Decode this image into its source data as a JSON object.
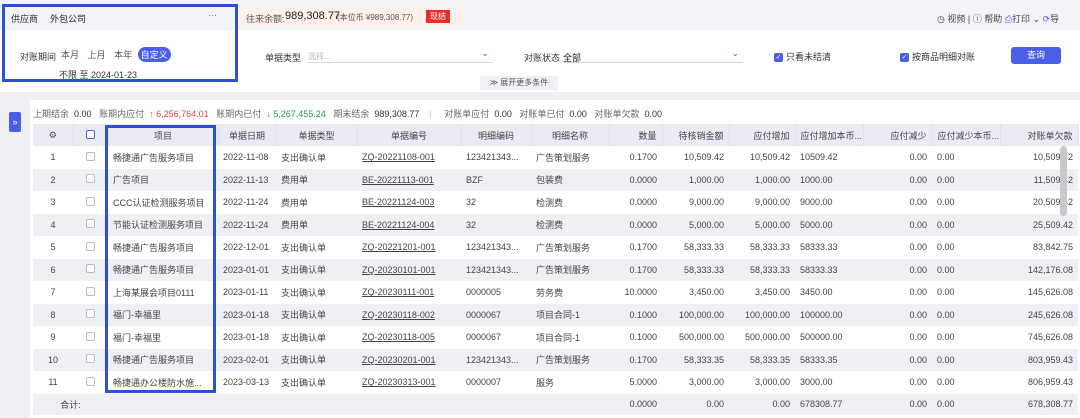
{
  "supplier": {
    "label": "供应商",
    "value": "外包公司",
    "more": "···"
  },
  "balance": {
    "label": "往来余额:",
    "value": "989,308.77",
    "local": "(本位币 ¥989,308.77)",
    "settle_button": "现结"
  },
  "toolbar": {
    "video": "视频",
    "help": "帮助",
    "print": "打印",
    "export": "导"
  },
  "period": {
    "label": "对账期间",
    "options": [
      "本月",
      "上月",
      "本年",
      "自定义"
    ],
    "selected": "自定义",
    "range": "不限 至 2024-01-23"
  },
  "doc_type": {
    "label": "单据类型",
    "placeholder": "选择..."
  },
  "status": {
    "label": "对账状态",
    "value": "全部"
  },
  "checks": {
    "unsettled_only": "只看未结清",
    "by_item_detail": "按商品明细对账"
  },
  "query_button": "查询",
  "expand_more": "展开更多条件",
  "summary": {
    "prev_balance_label": "上期结余",
    "prev_balance": "0.00",
    "payable_label": "账期内应付",
    "payable": "6,256,764.01",
    "paid_label": "账期内已付",
    "paid": "5,267,455.24",
    "end_balance_label": "期末结余",
    "end_balance": "989,308.77",
    "stmt_payable_label": "对账单应付",
    "stmt_payable": "0.00",
    "stmt_paid_label": "对账单已付",
    "stmt_paid": "0.00",
    "stmt_owed_label": "对账单欠款",
    "stmt_owed": "0.00"
  },
  "colors": {
    "accent": "#4a5ee8",
    "up": "#e64545",
    "down": "#1e9e4a",
    "highlight": "#2f50cf"
  },
  "table": {
    "headers": [
      "项目",
      "单据日期",
      "单据类型",
      "单据编号",
      "明细编码",
      "明细名称",
      "数量",
      "待核销金额",
      "应付增加",
      "应付增加本币...",
      "应付减少",
      "应付减少本币...",
      "对账单欠款"
    ],
    "rows": [
      [
        "1",
        "畅捷通广告服务项目",
        "2022-11-08",
        "支出确认单",
        "ZQ-20221108-001",
        "123421343...",
        "广告策划服务",
        "0.1700",
        "10,509.42",
        "10,509.42",
        "10509.42",
        "0.00",
        "0.00",
        "10,509.42"
      ],
      [
        "2",
        "广告项目",
        "2022-11-13",
        "费用单",
        "BE-20221113-001",
        "BZF",
        "包装费",
        "0.0000",
        "1,000.00",
        "1,000.00",
        "1000.00",
        "0.00",
        "0.00",
        "11,509.42"
      ],
      [
        "3",
        "CCC认证检测服务项目",
        "2022-11-24",
        "费用单",
        "BE-20221124-003",
        "32",
        "检测费",
        "0.0000",
        "9,000.00",
        "9,000.00",
        "9000.00",
        "0.00",
        "0.00",
        "20,509.42"
      ],
      [
        "4",
        "节能认证检测服务项目",
        "2022-11-24",
        "费用单",
        "BE-20221124-004",
        "32",
        "检测费",
        "0.0000",
        "5,000.00",
        "5,000.00",
        "5000.00",
        "0.00",
        "0.00",
        "25,509.42"
      ],
      [
        "5",
        "畅捷通广告服务项目",
        "2022-12-01",
        "支出确认单",
        "ZQ-20221201-001",
        "123421343...",
        "广告策划服务",
        "0.1700",
        "58,333.33",
        "58,333.33",
        "58333.33",
        "0.00",
        "0.00",
        "83,842.75"
      ],
      [
        "6",
        "畅捷通广告服务项目",
        "2023-01-01",
        "支出确认单",
        "ZQ-20230101-001",
        "123421343...",
        "广告策划服务",
        "0.1700",
        "58,333.33",
        "58,333.33",
        "58333.33",
        "0.00",
        "0.00",
        "142,176.08"
      ],
      [
        "7",
        "上海某展会项目0111",
        "2023-01-11",
        "支出确认单",
        "ZQ-20230111-001",
        "0000005",
        "劳务费",
        "10.0000",
        "3,450.00",
        "3,450.00",
        "3450.00",
        "0.00",
        "0.00",
        "145,626.08"
      ],
      [
        "8",
        "福门-幸福里",
        "2023-01-18",
        "支出确认单",
        "ZQ-20230118-002",
        "0000067",
        "项目合同-1",
        "0.1000",
        "100,000.00",
        "100,000.00",
        "100000.00",
        "0.00",
        "0.00",
        "245,626.08"
      ],
      [
        "9",
        "福门-幸福里",
        "2023-01-18",
        "支出确认单",
        "ZQ-20230118-005",
        "0000067",
        "项目合同-1",
        "0.1000",
        "500,000.00",
        "500,000.00",
        "500000.00",
        "0.00",
        "0.00",
        "745,626.08"
      ],
      [
        "10",
        "畅捷通广告服务项目",
        "2023-02-01",
        "支出确认单",
        "ZQ-20230201-001",
        "123421343...",
        "广告策划服务",
        "0.1700",
        "58,333.35",
        "58,333.35",
        "58333.35",
        "0.00",
        "0.00",
        "803,959.43"
      ],
      [
        "11",
        "畅捷通办公楼防水施...",
        "2023-03-13",
        "支出确认单",
        "ZQ-20230313-001",
        "0000007",
        "服务",
        "5.0000",
        "3,000.00",
        "3,000.00",
        "3000.00",
        "0.00",
        "0.00",
        "806,959.43"
      ]
    ],
    "total": {
      "label": "合计:",
      "values": [
        "0.0000",
        "0.00",
        "0.00",
        "678308.77",
        "0.00",
        "0.00",
        "678,308.77"
      ]
    }
  }
}
